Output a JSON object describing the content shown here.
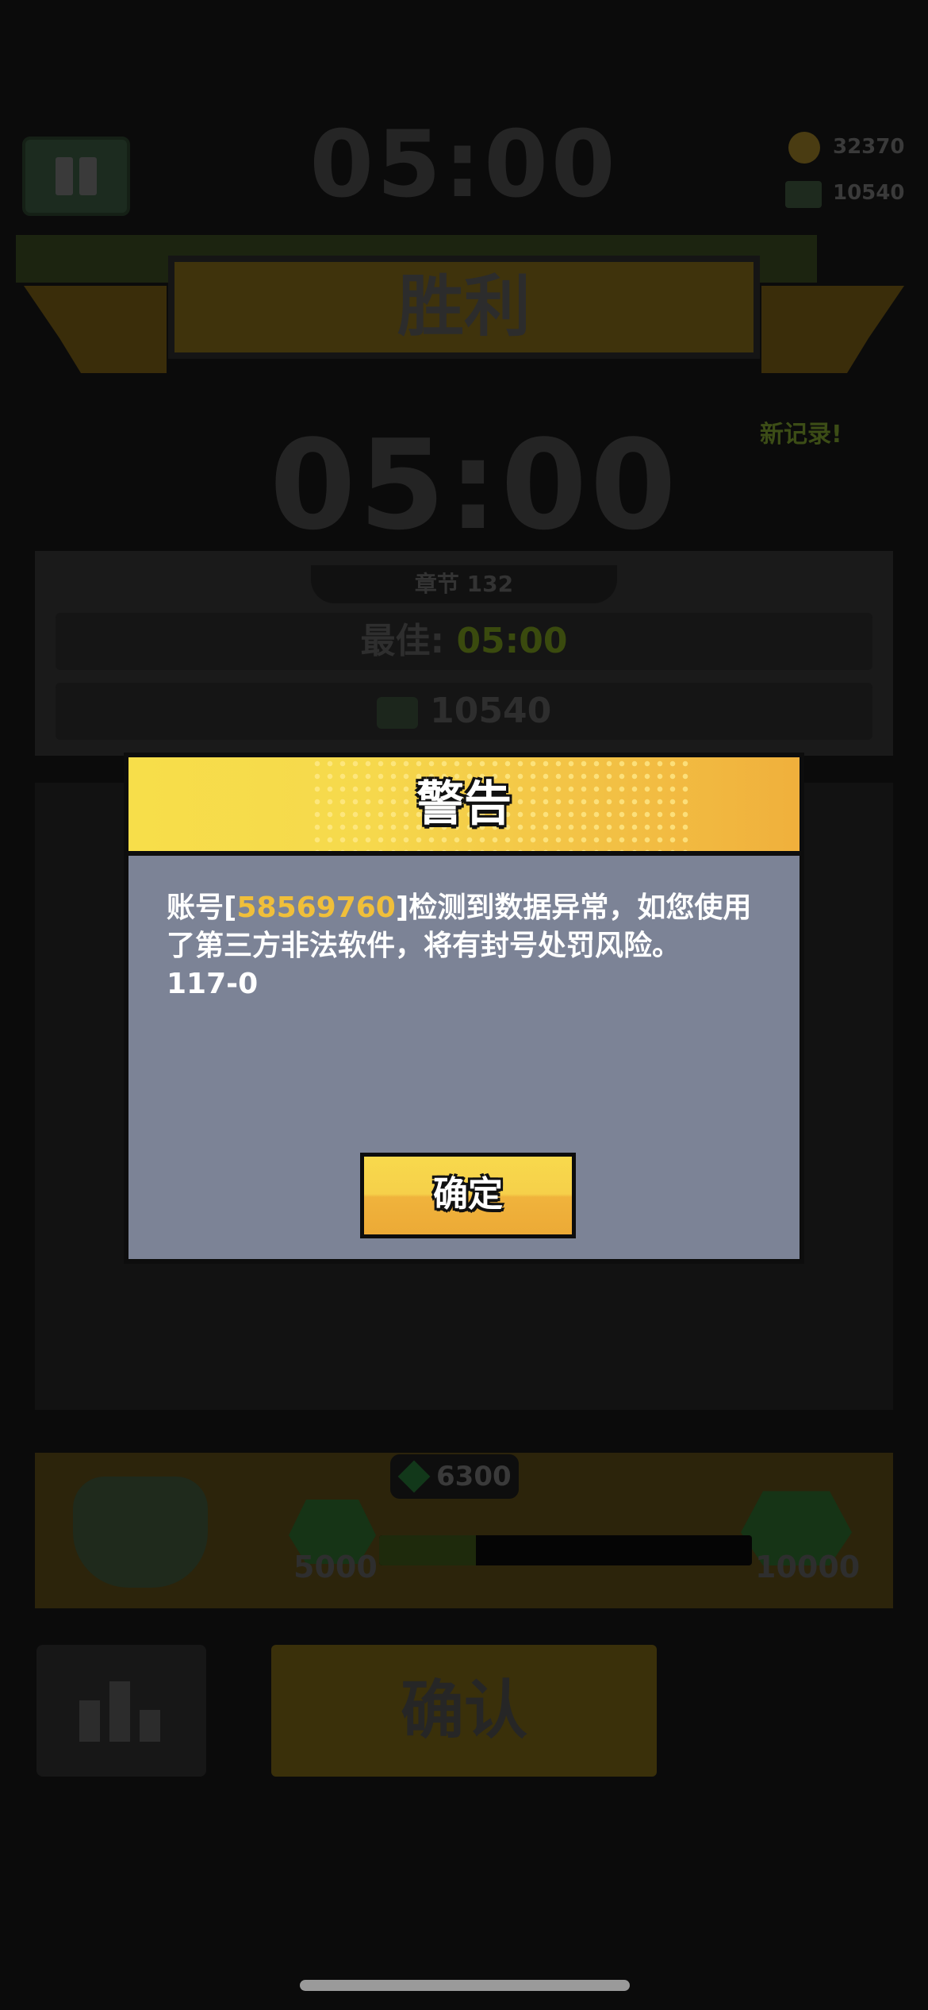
{
  "hud": {
    "timer": "05:00",
    "coins": "32370",
    "cash": "10540"
  },
  "result": {
    "banner": "胜利",
    "new_record": "新记录!",
    "time": "05:00",
    "chapter": "章节 132",
    "best_label": "最佳:",
    "best_value": "05:00",
    "reward": "10540"
  },
  "progress": {
    "current": "6300",
    "min_label": "5000",
    "max_label": "10000",
    "fill_fraction": 0.26
  },
  "bottom": {
    "confirm": "确认"
  },
  "dialog": {
    "title": "警告",
    "msg_prefix": "账号[",
    "account_id": "58569760",
    "msg_line1_rest": "]检测到数据异常，如您使用",
    "msg_line2": "了第三方非法软件，将有封号处罚风险。",
    "msg_line3": "117-0",
    "ok_label": "确定"
  },
  "colors": {
    "accent_yellow": "#f6d94c",
    "accent_orange": "#f0b03c",
    "account_highlight": "#f0bf3a",
    "dialog_body": "#7c8396"
  }
}
